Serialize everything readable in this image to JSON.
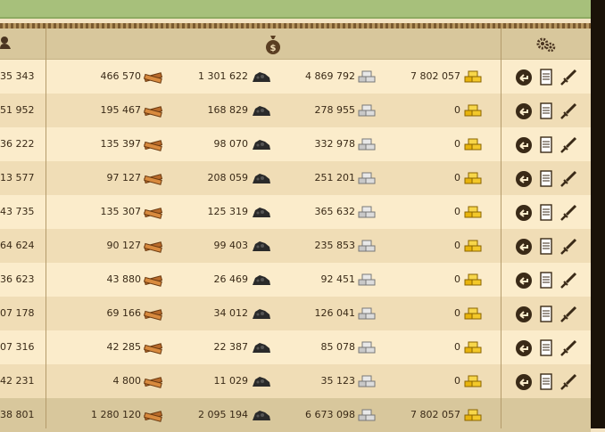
{
  "header": {
    "owner_icon": "person-icon",
    "resources_icon": "money-bag-icon",
    "actions_icon": "gears-icon"
  },
  "rows": [
    {
      "partial": "35 343",
      "wood": "466 570",
      "stone": "1 301 622",
      "iron": "4 869 792",
      "gold": "7 802 057"
    },
    {
      "partial": "51 952",
      "wood": "195 467",
      "stone": "168 829",
      "iron": "278 955",
      "gold": "0"
    },
    {
      "partial": "36 222",
      "wood": "135 397",
      "stone": "98 070",
      "iron": "332 978",
      "gold": "0"
    },
    {
      "partial": "13 577",
      "wood": "97 127",
      "stone": "208 059",
      "iron": "251 201",
      "gold": "0"
    },
    {
      "partial": "43 735",
      "wood": "135 307",
      "stone": "125 319",
      "iron": "365 632",
      "gold": "0"
    },
    {
      "partial": "64 624",
      "wood": "90 127",
      "stone": "99 403",
      "iron": "235 853",
      "gold": "0"
    },
    {
      "partial": "36 623",
      "wood": "43 880",
      "stone": "26 469",
      "iron": "92 451",
      "gold": "0"
    },
    {
      "partial": "07 178",
      "wood": "69 166",
      "stone": "34 012",
      "iron": "126 041",
      "gold": "0"
    },
    {
      "partial": "07 316",
      "wood": "42 285",
      "stone": "22 387",
      "iron": "85 078",
      "gold": "0"
    },
    {
      "partial": "42 231",
      "wood": "4 800",
      "stone": "11 029",
      "iron": "35 123",
      "gold": "0"
    }
  ],
  "total": {
    "partial": "38 801",
    "wood": "1 280 120",
    "stone": "2 095 194",
    "iron": "6 673 098",
    "gold": "7 802 057"
  },
  "icons": {
    "wood": "wood-icon",
    "stone": "stone-icon",
    "iron": "iron-icon",
    "gold": "gold-icon",
    "actions": [
      "return-icon",
      "report-icon",
      "sword-icon"
    ]
  },
  "colors": {
    "header_bg": "#d8c79c",
    "row_odd": "#fbeccb",
    "row_even": "#f0ddb6",
    "top_bar": "#a7c07b"
  }
}
